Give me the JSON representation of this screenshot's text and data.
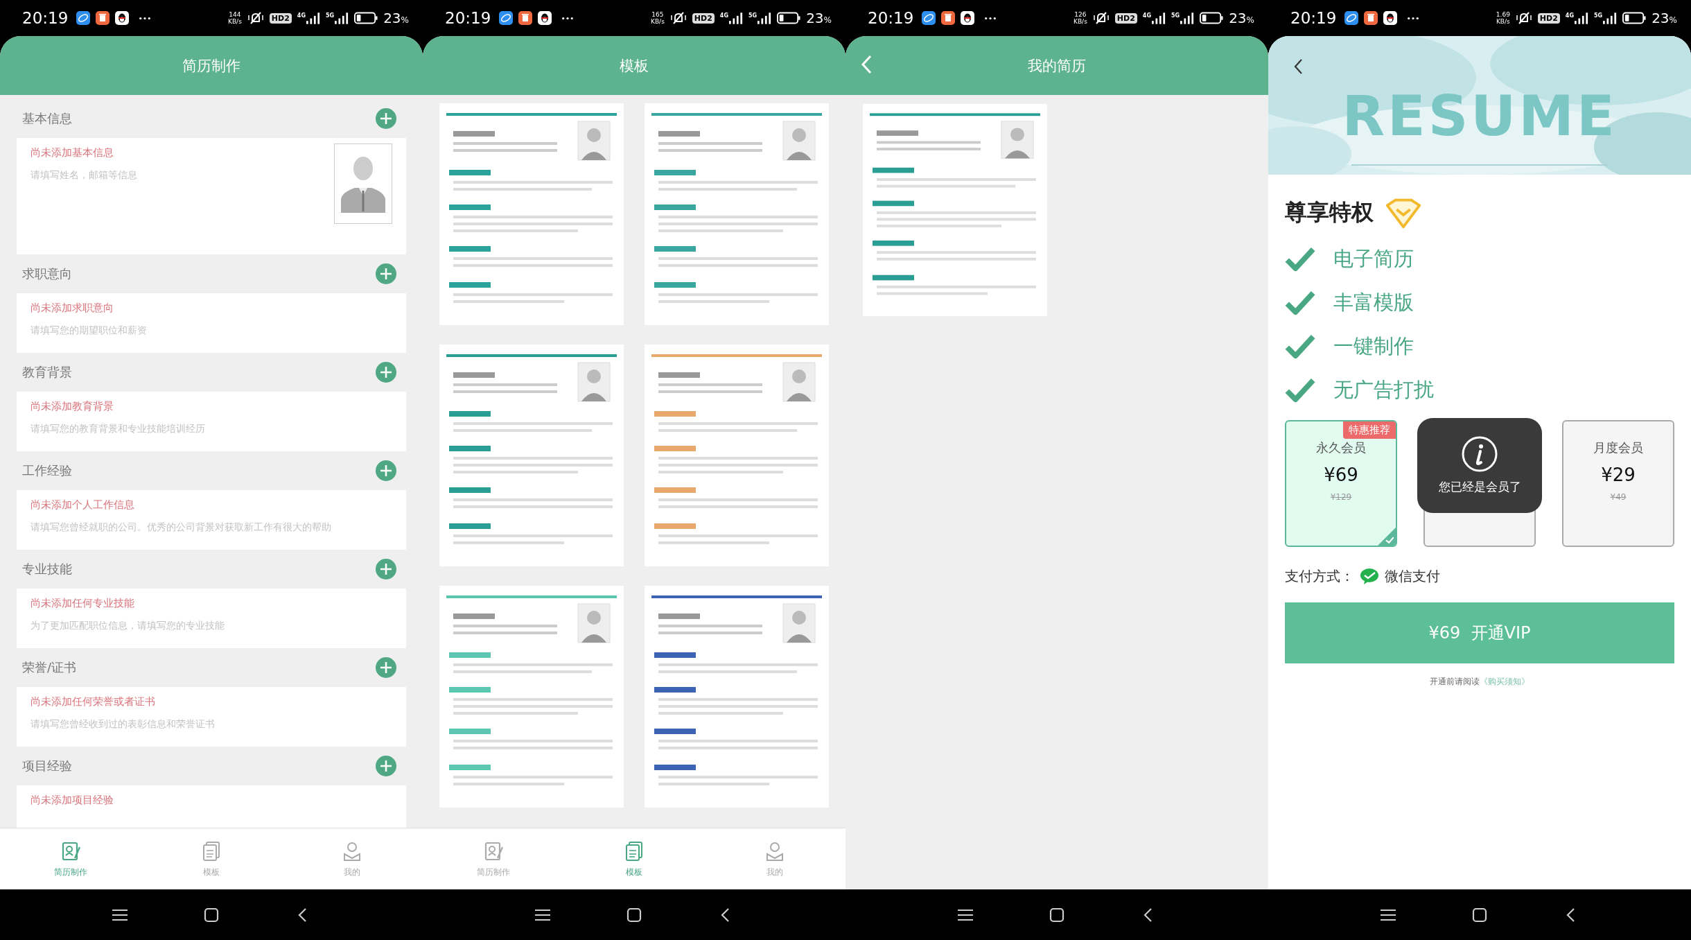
{
  "screens": [
    {
      "kind": "editor",
      "status_bar": {
        "time": "20:19",
        "speed": "144",
        "speed_unit": "KB/s",
        "hd": "HD2",
        "net_a": "4G",
        "net_b": "5G",
        "battery": "23",
        "battery_unit": "%"
      },
      "title": "简历制作",
      "sections": [
        {
          "title": "基本信息",
          "empty": "尚未添加基本信息",
          "hint": "请填写姓名，邮箱等信息",
          "photo": true
        },
        {
          "title": "求职意向",
          "empty": "尚未添加求职意向",
          "hint": "请填写您的期望职位和薪资",
          "photo": false
        },
        {
          "title": "教育背景",
          "empty": "尚未添加教育背景",
          "hint": "请填写您的教育背景和专业技能培训经历",
          "photo": false
        },
        {
          "title": "工作经验",
          "empty": "尚未添加个人工作信息",
          "hint": "请填写您曾经就职的公司。优秀的公司背景对获取新工作有很大的帮助",
          "photo": false
        },
        {
          "title": "专业技能",
          "empty": "尚未添加任何专业技能",
          "hint": "为了更加匹配职位信息，请填写您的专业技能",
          "photo": false
        },
        {
          "title": "荣誉/证书",
          "empty": "尚未添加任何荣誉或者证书",
          "hint": "请填写您曾经收到过的表彰信息和荣誉证书",
          "photo": false
        },
        {
          "title": "项目经验",
          "empty": "尚未添加项目经验",
          "photo": false
        }
      ],
      "tabs": [
        {
          "label": "简历制作",
          "selected": true
        },
        {
          "label": "模板",
          "selected": false
        },
        {
          "label": "我的",
          "selected": false
        }
      ]
    },
    {
      "kind": "templates",
      "status_bar": {
        "time": "20:19",
        "speed": "165",
        "speed_unit": "KB/s",
        "hd": "HD2",
        "net_a": "4G",
        "net_b": "5G",
        "battery": "23",
        "battery_unit": "%"
      },
      "title": "模板",
      "templates": [
        {
          "kind": "picture",
          "color": "#2aa39a"
        },
        {
          "kind": "picture",
          "color": "#3aa6a0"
        },
        {
          "kind": "picture",
          "color": "#2a9d94"
        },
        {
          "kind": "picture",
          "color": "#e9a86e"
        },
        {
          "kind": "picture",
          "color": "#5cc7b0"
        },
        {
          "kind": "picture",
          "color": "#3d63b5"
        }
      ],
      "tabs": [
        {
          "label": "简历制作",
          "selected": false
        },
        {
          "label": "模板",
          "selected": true
        },
        {
          "label": "我的",
          "selected": false
        }
      ]
    },
    {
      "kind": "my_resumes",
      "status_bar": {
        "time": "20:19",
        "speed": "126",
        "speed_unit": "KB/s",
        "hd": "HD2",
        "net_a": "4G",
        "net_b": "5G",
        "battery": "23",
        "battery_unit": "%"
      },
      "title": "我的简历",
      "resumes": [
        {
          "kind": "picture",
          "color": "#2a9d94"
        }
      ]
    },
    {
      "kind": "vip",
      "status_bar": {
        "time": "20:19",
        "speed": "1.69",
        "speed_unit": "KB/s",
        "hd": "HD2",
        "net_a": "4G",
        "net_b": "5G",
        "battery": "23",
        "battery_unit": "%"
      },
      "banner": "RESUME",
      "privilege_title": "尊享特权",
      "features": [
        "电子简历",
        "丰富模版",
        "一键制作",
        "无广告打扰"
      ],
      "plans": [
        {
          "name": "永久会员",
          "price": "¥69",
          "original": "¥129",
          "badge": "特惠推荐",
          "selected": true
        },
        {
          "selected": false
        },
        {
          "name": "月度会员",
          "price": "¥29",
          "original": "¥49",
          "selected": false
        }
      ],
      "toast": "您已经是会员了",
      "payment_label": "支付方式：",
      "payment_method": "微信支付",
      "button": "¥69  开通VIP",
      "notice": "开通前请阅读",
      "notice_link": "《购买须知》"
    }
  ]
}
